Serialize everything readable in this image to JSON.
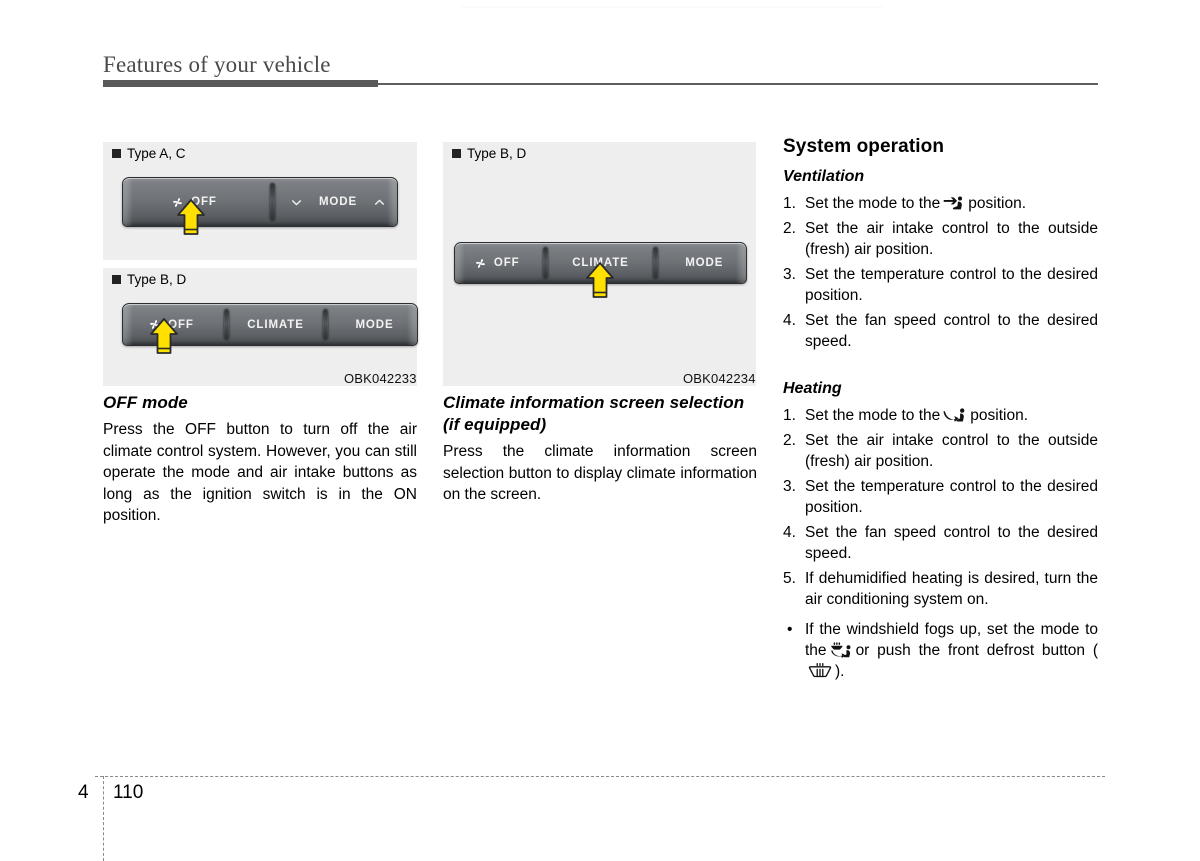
{
  "header": {
    "title": "Features of your vehicle"
  },
  "figures": {
    "fig_a": {
      "label": "Type A, C",
      "label_marker": "■",
      "controls": [
        {
          "id": "off",
          "icon": "fan-icon",
          "label": "OFF"
        },
        {
          "id": "mode",
          "icon_left": "chevron-down-icon",
          "label": "MODE",
          "icon_right": "chevron-up-icon"
        }
      ],
      "callout_target": "off"
    },
    "fig_b": {
      "label": "Type B, D",
      "label_marker": "■",
      "controls": [
        {
          "id": "off",
          "icon": "fan-icon",
          "label": "OFF"
        },
        {
          "id": "climate",
          "label": "CLIMATE"
        },
        {
          "id": "mode",
          "label": "MODE"
        }
      ],
      "callout_target": "off"
    },
    "fig_c": {
      "label": "Type B, D",
      "label_marker": "■",
      "controls": [
        {
          "id": "off",
          "icon": "fan-icon",
          "label": "OFF"
        },
        {
          "id": "climate",
          "label": "CLIMATE"
        },
        {
          "id": "mode",
          "label": "MODE"
        }
      ],
      "callout_target": "climate"
    },
    "code_left": "OBK042233",
    "code_right": "OBK042234"
  },
  "column_left": {
    "heading": "OFF mode",
    "paragraph": "Press the OFF button to turn off the air climate control system. However, you can still operate the mode and air intake buttons as long as the ignition switch is in the ON position."
  },
  "column_middle": {
    "heading": "Climate information screen selection  (if equipped)",
    "paragraph": "Press the climate information screen selection button to display climate information on the screen."
  },
  "column_right": {
    "heading": "System operation",
    "ventilation": {
      "heading": "Ventilation",
      "steps": [
        {
          "num": "1.",
          "before": "Set the mode to the",
          "icon": "face-vent-icon",
          "after": "position."
        },
        {
          "num": "2.",
          "text": "Set the air intake control to the outside (fresh) air position."
        },
        {
          "num": "3.",
          "text": "Set the temperature control to the desired position."
        },
        {
          "num": "4.",
          "text": "Set the fan speed control to the desired speed."
        }
      ]
    },
    "heating": {
      "heading": "Heating",
      "steps": [
        {
          "num": "1.",
          "before": "Set the mode to the",
          "icon": "floor-vent-icon",
          "after": "position."
        },
        {
          "num": "2.",
          "text": "Set the air intake control to the outside (fresh) air position."
        },
        {
          "num": "3.",
          "text": "Set the temperature control to the desired position."
        },
        {
          "num": "4.",
          "text": "Set the fan speed control to the desired speed."
        },
        {
          "num": "5.",
          "text": "If dehumidified heating is desired, turn the air conditioning system on."
        }
      ],
      "bullets": [
        {
          "dot": "•",
          "part1": "If the windshield fogs up, set the mode to the",
          "icon1": "defrost-floor-icon",
          "part2": "or push the front defrost button (",
          "icon2": "front-defrost-icon",
          "part3": ")."
        }
      ]
    }
  },
  "footer": {
    "chapter": "4",
    "page": "110"
  },
  "colors": {
    "figure_bg": "#eeeeee",
    "control_dark": "#6e7276",
    "callout_yellow": "#ffe000",
    "rule_gray": "#595959"
  }
}
